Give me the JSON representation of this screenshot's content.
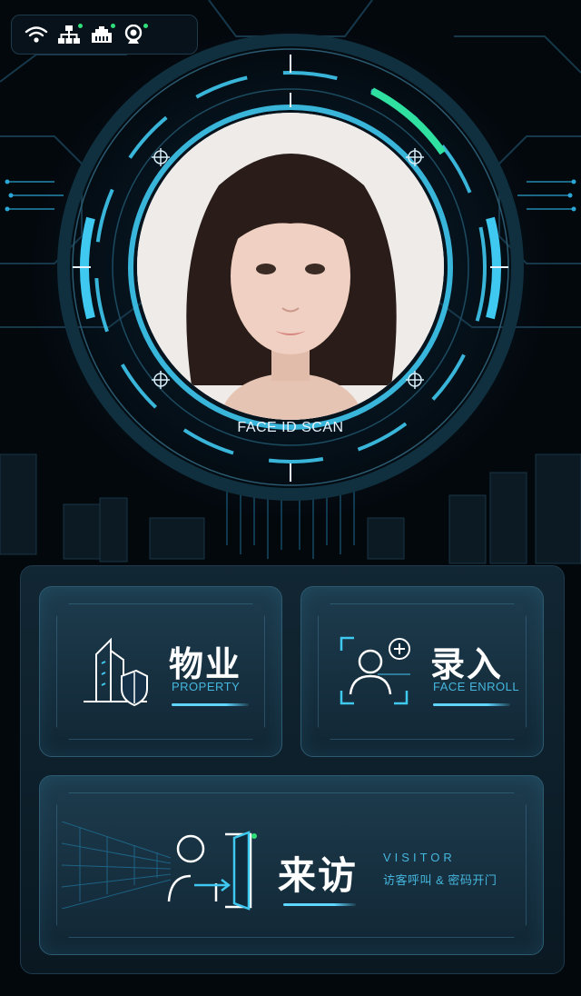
{
  "status_bar": {
    "icons": [
      "wifi-icon",
      "network-icon",
      "ethernet-port-icon",
      "camera-icon"
    ],
    "indicator_color": "#2fe07a"
  },
  "scan": {
    "label": "FACE ID SCAN",
    "accent_color": "#3fc8f0",
    "progress_color": "#2fe0a0"
  },
  "cards": {
    "property": {
      "title": "物业",
      "subtitle": "PROPERTY"
    },
    "enroll": {
      "title": "录入",
      "subtitle": "FACE ENROLL"
    },
    "visitor": {
      "title": "来访",
      "subtitle": "VISITOR",
      "description": "访客呼叫 & 密码开门"
    }
  }
}
